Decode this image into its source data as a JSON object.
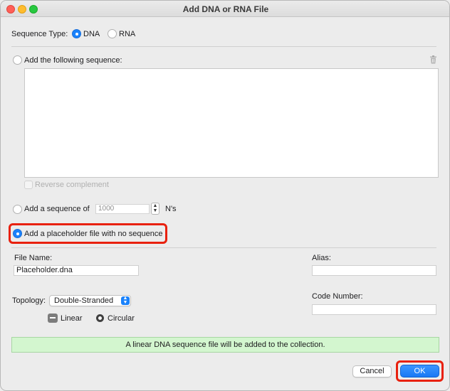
{
  "window": {
    "title": "Add DNA or RNA File"
  },
  "sequence_type": {
    "label": "Sequence Type:",
    "options": [
      "DNA",
      "RNA"
    ],
    "selected": "DNA"
  },
  "add_sequence": {
    "label": "Add the following sequence:",
    "text": "",
    "reverse_complement_label": "Reverse complement"
  },
  "add_ns": {
    "label": "Add a sequence of",
    "value": "1000",
    "suffix": "N's"
  },
  "placeholder": {
    "label": "Add a placeholder file with no sequence",
    "selected": true
  },
  "file_name": {
    "label": "File Name:",
    "value": "Placeholder.dna"
  },
  "alias": {
    "label": "Alias:",
    "value": ""
  },
  "code_number": {
    "label": "Code Number:",
    "value": ""
  },
  "topology": {
    "label": "Topology:",
    "value": "Double-Stranded",
    "shapes": [
      "Linear",
      "Circular"
    ]
  },
  "info": {
    "message": "A linear DNA sequence file will be added to the collection."
  },
  "buttons": {
    "cancel": "Cancel",
    "ok": "OK"
  },
  "colors": {
    "accent": "#1a82fb",
    "highlight": "#e8210e",
    "info_bg": "#d3f6cf"
  }
}
